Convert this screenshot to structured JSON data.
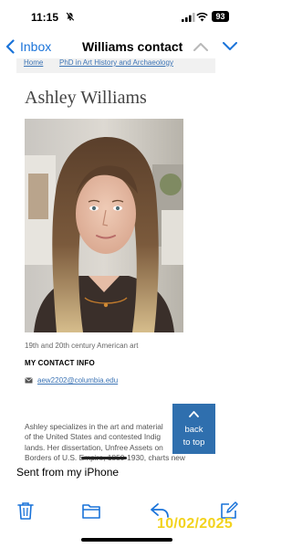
{
  "status_bar": {
    "time": "11:15",
    "battery_level": "93",
    "icons": [
      "mute-icon",
      "signal-icon",
      "wifi-icon",
      "battery-icon"
    ]
  },
  "nav": {
    "back_label": "Inbox",
    "title": "Williams contact",
    "icons": [
      "chevron-left-icon",
      "chevron-up-icon",
      "chevron-down-icon"
    ]
  },
  "page": {
    "breadcrumb": [
      "Home",
      "PhD in Art History and Archaeology"
    ],
    "name": "Ashley Williams",
    "research_field": "19th and 20th century American art",
    "contact_heading": "MY CONTACT INFO",
    "email": "aew2202@columbia.edu",
    "bio_lines": [
      "Ashley specializes in the art and material",
      "of the United States and contested Indig",
      "lands. Her dissertation, Unfree Assets on",
      "Borders of U.S. Empire, 1850-1930, charts new"
    ],
    "back_to_top": [
      "back",
      "to top"
    ]
  },
  "signature": "Sent from my iPhone",
  "toolbar": {
    "icons": [
      "trash-icon",
      "folder-icon",
      "reply-icon",
      "compose-icon"
    ]
  },
  "timestamp_overlay": "10/02/2025",
  "colors": {
    "link": "#3c74b5",
    "ios_blue": "#1a73d9",
    "back_to_top_bg": "#2f6fae",
    "timestamp": "#f3d31e"
  }
}
